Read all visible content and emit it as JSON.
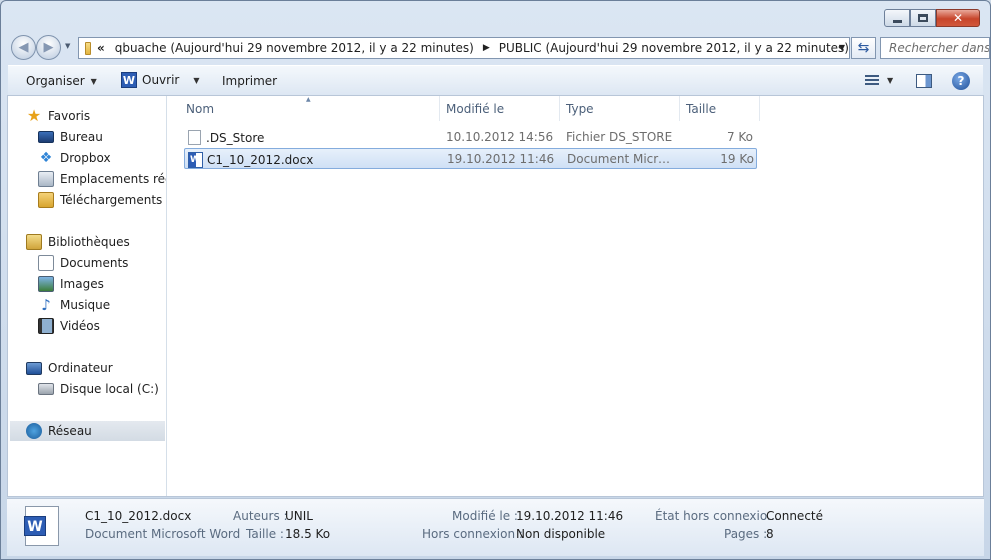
{
  "window": {
    "close_glyph": "✕"
  },
  "address_bar": {
    "overflow_glyph": "«",
    "crumbs": [
      "qbuache (Aujourd'hui 29 novembre 2012, il y a 22 minutes)",
      "PUBLIC (Aujourd'hui 29 novembre 2012, il y a 22 minutes)"
    ],
    "search_placeholder": "Rechercher dans"
  },
  "toolbar": {
    "organize_label": "Organiser",
    "open_label": "Ouvrir",
    "print_label": "Imprimer"
  },
  "nav_pane": {
    "favorites": {
      "header": "Favoris",
      "items": [
        "Bureau",
        "Dropbox",
        "Emplacements récents",
        "Téléchargements"
      ]
    },
    "libraries": {
      "header": "Bibliothèques",
      "items": [
        "Documents",
        "Images",
        "Musique",
        "Vidéos"
      ]
    },
    "computer": {
      "header": "Ordinateur",
      "items": [
        "Disque local (C:)"
      ]
    },
    "network": {
      "header": "Réseau",
      "selected": true
    }
  },
  "file_list": {
    "columns": [
      "Nom",
      "Modifié le",
      "Type",
      "Taille"
    ],
    "sorted_by": "Nom",
    "rows": [
      {
        "name": ".DS_Store",
        "modified": "10.10.2012 14:56",
        "type": "Fichier DS_STORE",
        "size": "7 Ko",
        "selected": false
      },
      {
        "name": "C1_10_2012.docx",
        "modified": "19.10.2012 11:46",
        "type": "Document Microsoft Word",
        "size": "19 Ko",
        "selected": true
      }
    ]
  },
  "details": {
    "filename": "C1_10_2012.docx",
    "filetype": "Document Microsoft Word",
    "authors_label": "Auteurs :",
    "authors_value": "UNIL",
    "size_label": "Taille :",
    "size_value": "18.5 Ko",
    "modified_label": "Modifié le :",
    "modified_value": "19.10.2012 11:46",
    "offline_conn_label": "Hors connexion :",
    "offline_conn_value": "Non disponible",
    "offline_state_label": "État hors connexio...",
    "offline_state_value": "Connecté",
    "pages_label": "Pages :",
    "pages_value": "8"
  }
}
